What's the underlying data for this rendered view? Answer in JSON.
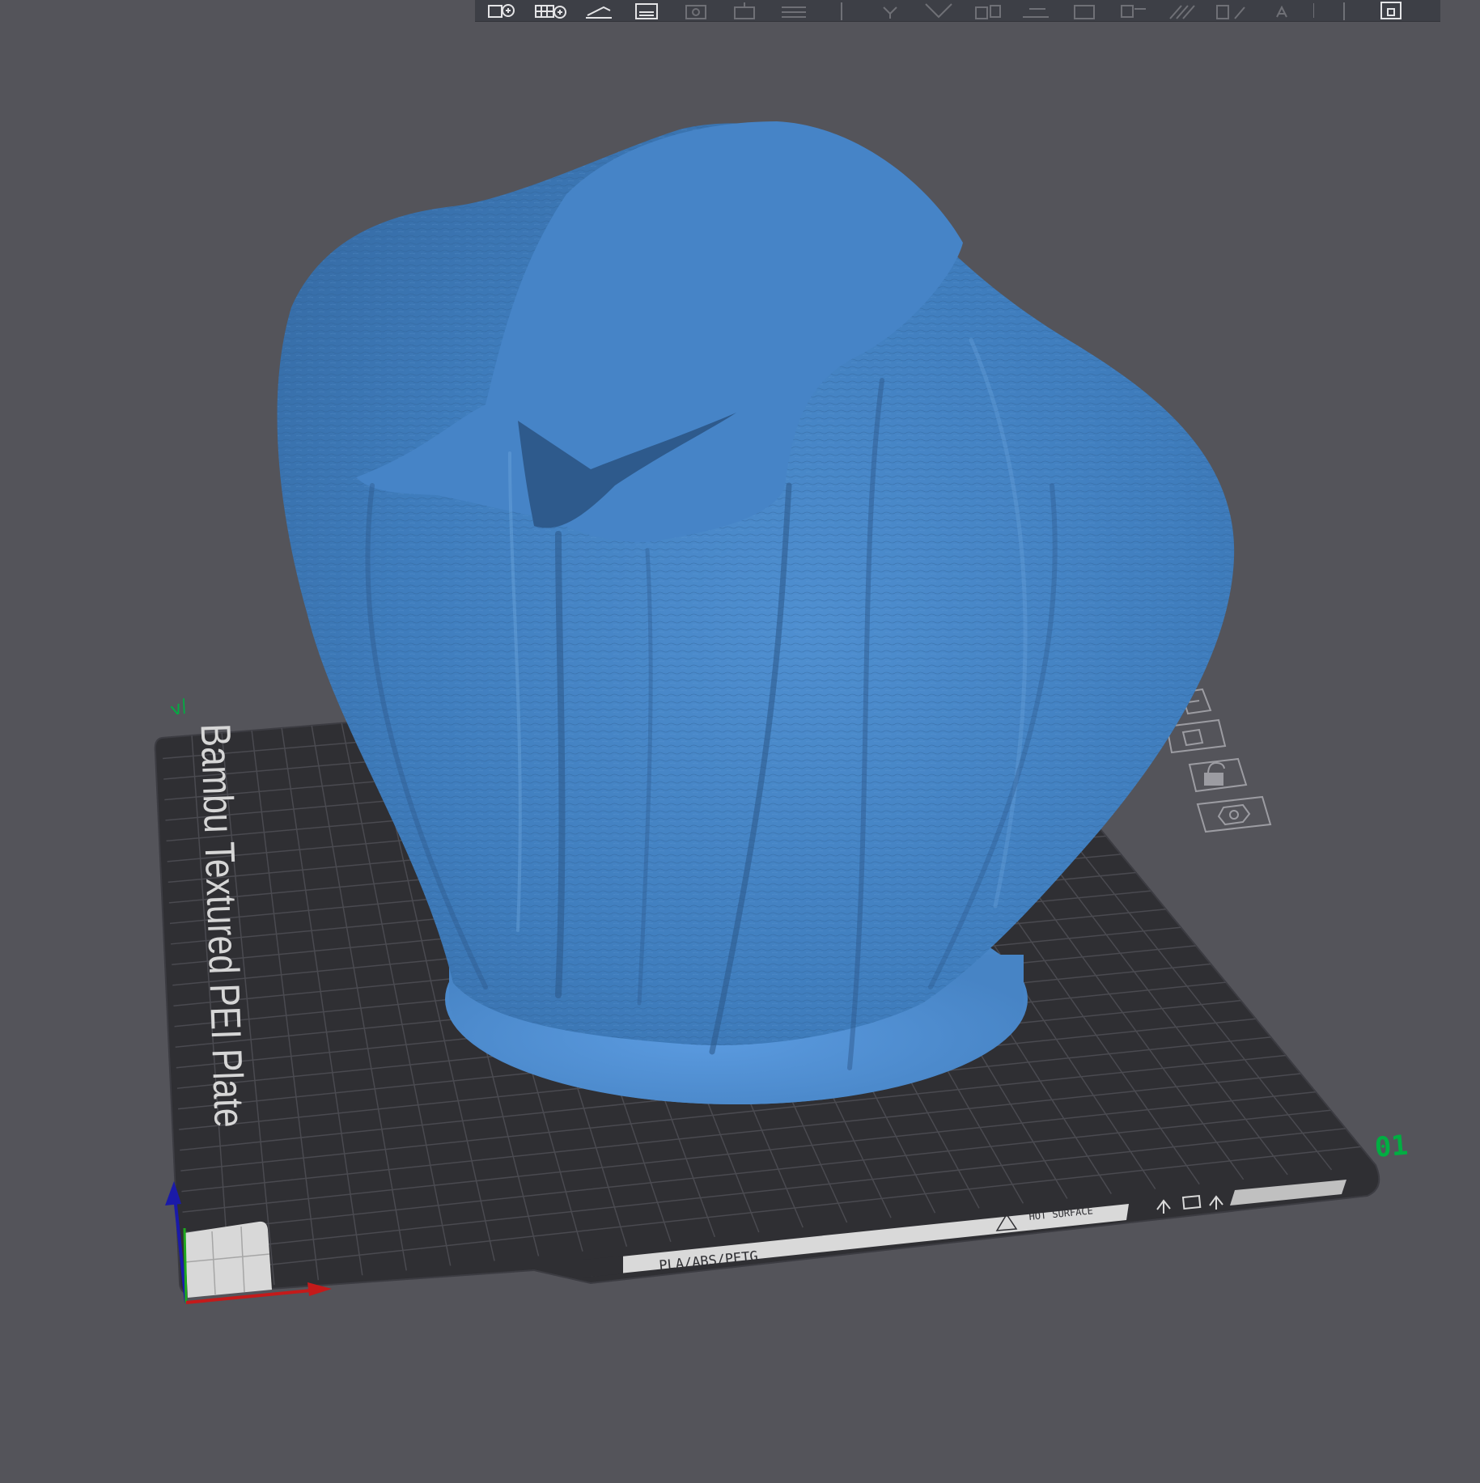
{
  "app": {
    "view": "3D Prepare view",
    "accent_color": "#00ae42",
    "model_color": "#4a8acb",
    "background_color": "#54545a"
  },
  "toolbar": {
    "items": [
      {
        "icon": "add-object-icon",
        "enabled": true
      },
      {
        "icon": "add-plate-icon",
        "enabled": true
      },
      {
        "icon": "auto-orient-icon",
        "enabled": true
      },
      {
        "icon": "arrange-icon",
        "enabled": true
      },
      {
        "icon": "split-to-objects-icon",
        "enabled": false
      },
      {
        "icon": "split-to-parts-icon",
        "enabled": false
      },
      {
        "icon": "layers-icon",
        "enabled": false
      },
      {
        "icon": "move-icon",
        "enabled": false
      },
      {
        "icon": "rotate-icon",
        "enabled": false
      },
      {
        "icon": "scale-icon",
        "enabled": false
      },
      {
        "icon": "lay-on-face-icon",
        "enabled": false
      },
      {
        "icon": "cut-icon",
        "enabled": false
      },
      {
        "icon": "support-paint-icon",
        "enabled": false
      },
      {
        "icon": "seam-paint-icon",
        "enabled": false
      },
      {
        "icon": "color-paint-icon",
        "enabled": false
      },
      {
        "icon": "mesh-boolean-icon",
        "enabled": false
      },
      {
        "icon": "emboss-text-icon",
        "enabled": false
      },
      {
        "icon": "measure-icon",
        "enabled": false
      },
      {
        "icon": "assembly-view-icon",
        "enabled": true
      }
    ]
  },
  "plate": {
    "name": "Bambu Textured PEI Plate",
    "number": "01",
    "materials_label": "PLA/ABS/PETG",
    "hot_surface_label": "HOT SURFACE",
    "corner_marker": "v/"
  },
  "plate_toolbar": [
    {
      "icon": "plate-auto-orient-icon"
    },
    {
      "icon": "plate-arrange-icon"
    },
    {
      "icon": "plate-lock-icon"
    },
    {
      "icon": "plate-settings-icon"
    }
  ]
}
